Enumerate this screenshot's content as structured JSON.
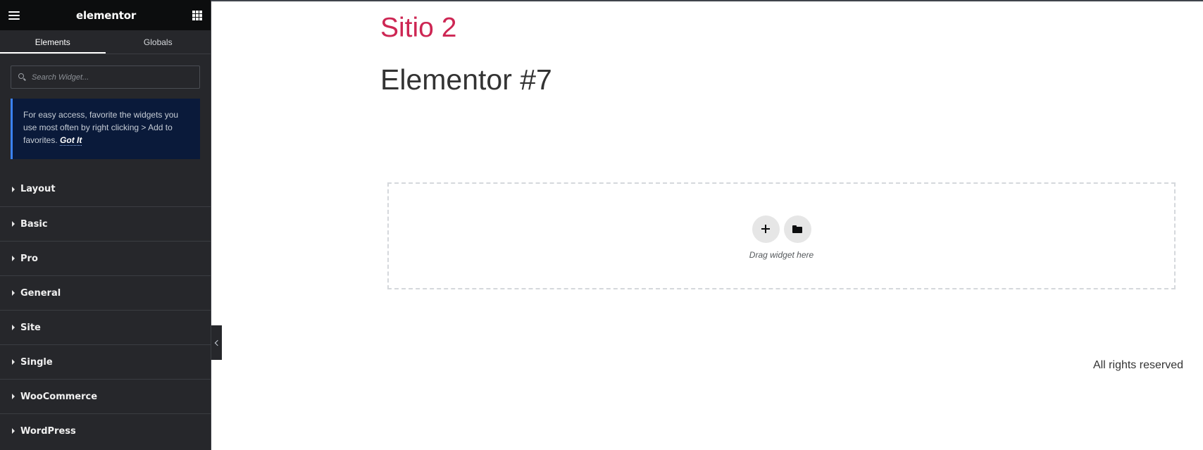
{
  "panel": {
    "logo": "elementor",
    "tabs": [
      {
        "label": "Elements",
        "active": true
      },
      {
        "label": "Globals",
        "active": false
      }
    ],
    "search": {
      "placeholder": "Search Widget..."
    },
    "notice": {
      "text": "For easy access, favorite the widgets you use most often by right clicking > Add to favorites.",
      "link": "Got It"
    },
    "categories": [
      {
        "label": "Layout"
      },
      {
        "label": "Basic"
      },
      {
        "label": "Pro"
      },
      {
        "label": "General"
      },
      {
        "label": "Site"
      },
      {
        "label": "Single"
      },
      {
        "label": "WooCommerce"
      },
      {
        "label": "WordPress"
      }
    ]
  },
  "canvas": {
    "site_title": "Sitio 2",
    "page_title": "Elementor #7",
    "dropzone_text": "Drag widget here",
    "footer": "All rights reserved"
  },
  "icons": {
    "menu": "hamburger-icon",
    "apps": "grid-icon",
    "search": "search-icon",
    "add": "plus-icon",
    "templates": "folder-icon",
    "collapse": "chevron-left-icon"
  },
  "colors": {
    "panel_bg": "#26272b",
    "header_bg": "#0c0d0e",
    "site_title": "#cd2653",
    "notice_accent": "#3b82f6"
  }
}
